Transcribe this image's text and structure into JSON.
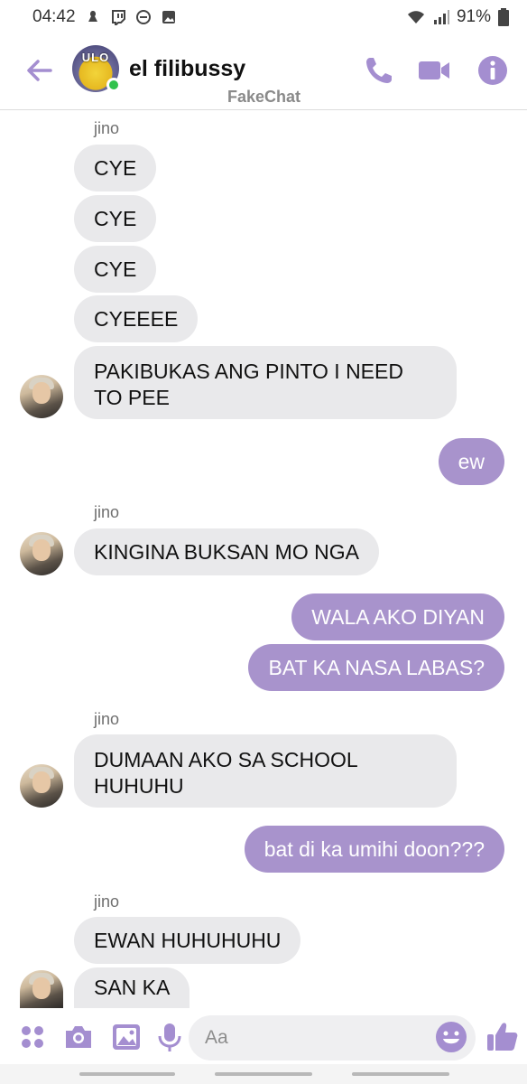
{
  "status_bar": {
    "time": "04:42",
    "battery": "91%"
  },
  "header": {
    "title": "el filibussy",
    "avatar_text": "ULO",
    "watermark": "FakeChat",
    "icons": [
      "back-arrow-icon",
      "phone-icon",
      "video-icon",
      "info-icon"
    ]
  },
  "messages": [
    {
      "sender": "jino"
    },
    {
      "text": "CYE",
      "from": "them"
    },
    {
      "text": "CYE",
      "from": "them"
    },
    {
      "text": "CYE",
      "from": "them"
    },
    {
      "text": "CYEEEE",
      "from": "them"
    },
    {
      "text": "PAKIBUKAS ANG PINTO I NEED TO PEE",
      "from": "them"
    },
    {
      "text": "ew",
      "from": "me"
    },
    {
      "sender": "jino"
    },
    {
      "text": "KINGINA BUKSAN MO NGA",
      "from": "them"
    },
    {
      "text": "WALA AKO DIYAN",
      "from": "me"
    },
    {
      "text": "BAT KA NASA LABAS?",
      "from": "me"
    },
    {
      "sender": "jino"
    },
    {
      "text": "DUMAAN AKO SA SCHOOL HUHUHU",
      "from": "them"
    },
    {
      "text": "bat di ka umihi doon???",
      "from": "me"
    },
    {
      "sender": "jino"
    },
    {
      "text": "EWAN HUHUHUHU",
      "from": "them"
    },
    {
      "text": "SAN KA",
      "from": "them"
    }
  ],
  "composer": {
    "placeholder": "Aa",
    "icons": [
      "apps-icon",
      "camera-icon",
      "image-icon",
      "microphone-icon",
      "emoji-icon",
      "thumbs-up-icon"
    ]
  },
  "colors": {
    "accent": "#a893cc",
    "incoming_bubble": "#e9e9eb",
    "online": "#31c24d"
  }
}
